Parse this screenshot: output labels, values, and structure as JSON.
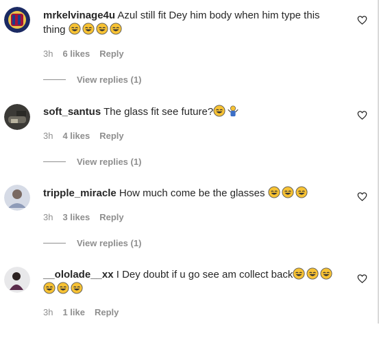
{
  "comments": [
    {
      "username": "mrkelvinage4u",
      "text": "Azul still fit Dey him body when him type this thing",
      "emojis": [
        "grin-sweat-icon",
        "grin-sweat-icon",
        "grin-sweat-icon",
        "grin-sweat-icon"
      ],
      "time": "3h",
      "likes": "6 likes",
      "reply": "Reply",
      "view_replies": "View replies (1)"
    },
    {
      "username": "soft_santus",
      "text": "The glass fit see future?",
      "emojis": [
        "grin-sweat-icon",
        "person-shrugging-icon"
      ],
      "time": "3h",
      "likes": "4 likes",
      "reply": "Reply",
      "view_replies": "View replies (1)"
    },
    {
      "username": "tripple_miracle",
      "text": "How much come be the glasses",
      "emojis": [
        "grin-sweat-icon",
        "grin-sweat-icon",
        "grin-sweat-icon"
      ],
      "time": "3h",
      "likes": "3 likes",
      "reply": "Reply",
      "view_replies": "View replies (1)"
    },
    {
      "username": "__ololade__xx",
      "text": "I Dey doubt if u go see am collect back",
      "emojis": [
        "grin-sweat-icon",
        "grin-sweat-icon",
        "grin-sweat-icon",
        "grin-sweat-icon",
        "grin-sweat-icon",
        "grin-sweat-icon"
      ],
      "time": "3h",
      "likes": "1 like",
      "reply": "Reply"
    }
  ],
  "colors": {
    "text": "#262626",
    "muted": "#8e8e8e",
    "emoji_face": "#f7c234"
  }
}
